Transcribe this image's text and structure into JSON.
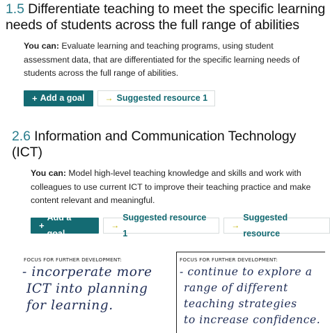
{
  "section1": {
    "number": "1.5",
    "title_line1": "Differentiate teaching to meet the specific learning",
    "title_line2": "needs of students across the full range of abilities",
    "you_can": "You can:",
    "desc_line1": " Evaluate learning and teaching programs, using student",
    "desc_line2": "assessment data, that are differentiated for the specific learning needs of",
    "desc_line3": "students across the full range of abilities.",
    "add_goal": "Add a goal",
    "resource1": "Suggested resource 1"
  },
  "section2": {
    "number": "2.6",
    "title_line1": "Information and Communication Technology",
    "title_line2": "(ICT)",
    "you_can": "You can:",
    "desc_line1": " Model high-level teaching knowledge and skills and work with",
    "desc_line2": "colleagues to use current ICT to improve their teaching practice and make",
    "desc_line3": "content relevant and meaningful.",
    "add_goal": "Add a goal",
    "resource1": "Suggested resource 1",
    "resource2": "Suggested resource"
  },
  "notes": {
    "left_label": "FOCUS FOR FURTHER DEVELOPMENT:",
    "left_lines": [
      "- incorperate more",
      "ICT into planning",
      "for learning."
    ],
    "right_label": "FOCUS FOR FURTHER DEVELOPMENT:",
    "right_lines": [
      "- continue to explore a",
      "range of different",
      "teaching strategies",
      "to increase confidence."
    ]
  },
  "icons": {
    "plus": "plus-icon",
    "arrow": "arrow-right-icon"
  },
  "colors": {
    "accent": "#146b73",
    "number": "#2a7d8c",
    "arrow": "#c2b400",
    "ink": "#1e2c55"
  }
}
